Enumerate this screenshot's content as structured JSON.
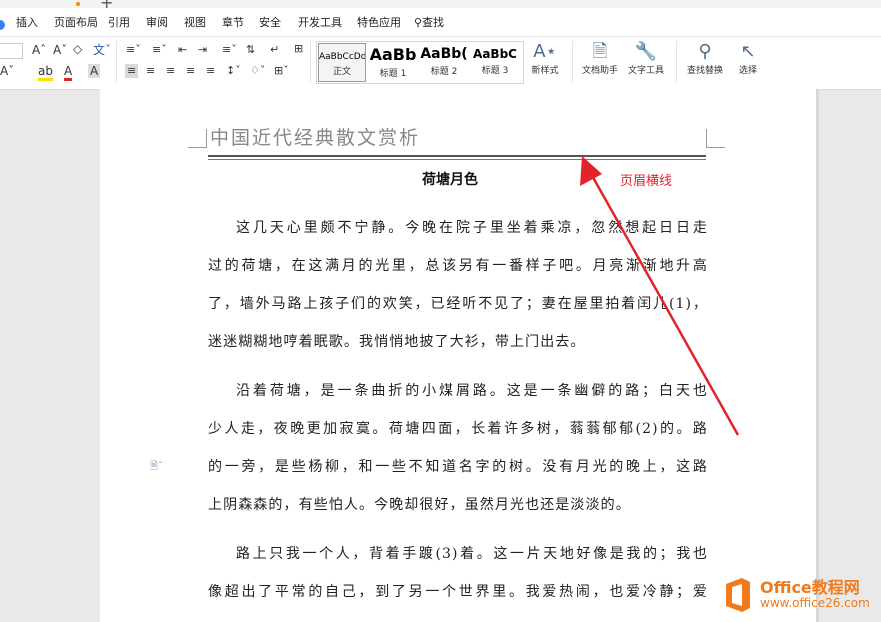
{
  "menubar": {
    "items": [
      "插入",
      "页面布局",
      "引用",
      "审阅",
      "视图",
      "章节",
      "安全",
      "开发工具",
      "特色应用"
    ],
    "search": "查找"
  },
  "ribbon": {
    "styles": [
      {
        "sample": "AaBbCcDd",
        "name": "正文"
      },
      {
        "sample": "AaBb",
        "name": "标题 1"
      },
      {
        "sample": "AaBb(",
        "name": "标题 2"
      },
      {
        "sample": "AaBbC",
        "name": "标题 3"
      }
    ],
    "new_style": "新样式",
    "doc_helper": "文档助手",
    "text_tools": "文字工具",
    "find_replace": "查找替换",
    "select": "选择"
  },
  "document": {
    "header": "中国近代经典散文赏析",
    "title": "荷塘月色",
    "paragraphs": [
      [
        "这几天心里颇不宁静。今晚在院子里坐着乘凉，忽然想起日日走",
        "过的荷塘，在这满月的光里，总该另有一番样子吧。月亮渐渐地升高",
        "了，墙外马路上孩子们的欢笑，已经听不见了；妻在屋里拍着闰儿(1)，",
        "迷迷糊糊地哼着眠歌。我悄悄地披了大衫，带上门出去。"
      ],
      [
        "沿着荷塘，是一条曲折的小煤屑路。这是一条幽僻的路；白天也",
        "少人走，夜晚更加寂寞。荷塘四面，长着许多树，蓊蓊郁郁(2)的。路",
        "的一旁，是些杨柳，和一些不知道名字的树。没有月光的晚上，这路",
        "上阴森森的，有些怕人。今晚却很好，虽然月光也还是淡淡的。"
      ],
      [
        "路上只我一个人，背着手踱(3)着。这一片天地好像是我的；我也",
        "像超出了平常的自己，到了另一个世界里。我爱热闹，也爱冷静；爱"
      ]
    ]
  },
  "annotation": "页眉横线",
  "watermark": {
    "line1": "Office教程网",
    "line2": "www.office26.com"
  },
  "colors": {
    "annotation": "#e2232a",
    "watermark": "#f07b1c"
  }
}
